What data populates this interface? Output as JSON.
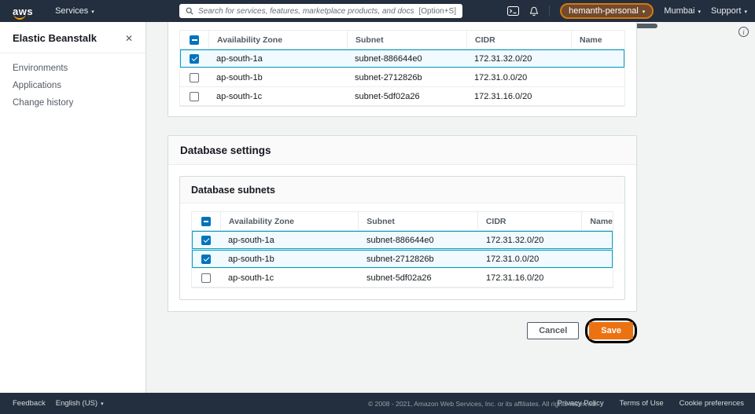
{
  "navbar": {
    "logo": "aws",
    "services_label": "Services",
    "search": {
      "placeholder": "Search for services, features, marketplace products, and docs",
      "shortcut": "[Option+S]"
    },
    "account_label": "hemanth-personal",
    "region_label": "Mumbai",
    "support_label": "Support"
  },
  "icons": {
    "caret_down": "▾",
    "close": "✕",
    "info": "i"
  },
  "sidebar": {
    "title": "Elastic Beanstalk",
    "items": [
      {
        "label": "Environments"
      },
      {
        "label": "Applications"
      },
      {
        "label": "Change history"
      }
    ]
  },
  "main": {
    "subnets_table": {
      "header_checkbox": "indeterminate",
      "columns": [
        "Availability Zone",
        "Subnet",
        "CIDR",
        "Name"
      ],
      "rows": [
        {
          "checked": true,
          "selected": true,
          "az": "ap-south-1a",
          "subnet": "subnet-886644e0",
          "cidr": "172.31.32.0/20",
          "name": ""
        },
        {
          "checked": false,
          "selected": false,
          "az": "ap-south-1b",
          "subnet": "subnet-2712826b",
          "cidr": "172.31.0.0/20",
          "name": ""
        },
        {
          "checked": false,
          "selected": false,
          "az": "ap-south-1c",
          "subnet": "subnet-5df02a26",
          "cidr": "172.31.16.0/20",
          "name": ""
        }
      ]
    },
    "database_settings": {
      "title": "Database settings",
      "subnets": {
        "title": "Database subnets",
        "header_checkbox": "indeterminate",
        "columns": [
          "Availability Zone",
          "Subnet",
          "CIDR",
          "Name"
        ],
        "rows": [
          {
            "checked": true,
            "selected": true,
            "az": "ap-south-1a",
            "subnet": "subnet-886644e0",
            "cidr": "172.31.32.0/20",
            "name": ""
          },
          {
            "checked": true,
            "selected": true,
            "az": "ap-south-1b",
            "subnet": "subnet-2712826b",
            "cidr": "172.31.0.0/20",
            "name": ""
          },
          {
            "checked": false,
            "selected": false,
            "az": "ap-south-1c",
            "subnet": "subnet-5df02a26",
            "cidr": "172.31.16.0/20",
            "name": ""
          }
        ]
      }
    },
    "actions": {
      "cancel_label": "Cancel",
      "save_label": "Save"
    }
  },
  "footer": {
    "feedback_label": "Feedback",
    "language_label": "English (US)",
    "copyright": "© 2008 - 2021, Amazon Web Services, Inc. or its affiliates. All rights reserved.",
    "links": [
      {
        "label": "Privacy Policy"
      },
      {
        "label": "Terms of Use"
      },
      {
        "label": "Cookie preferences"
      }
    ]
  },
  "colors": {
    "navbar_bg": "#232f3e",
    "accent_orange": "#ec7211",
    "checkbox_blue": "#0073bb",
    "selected_row_bg": "#f1faff",
    "selected_row_border": "#00a1c9"
  }
}
